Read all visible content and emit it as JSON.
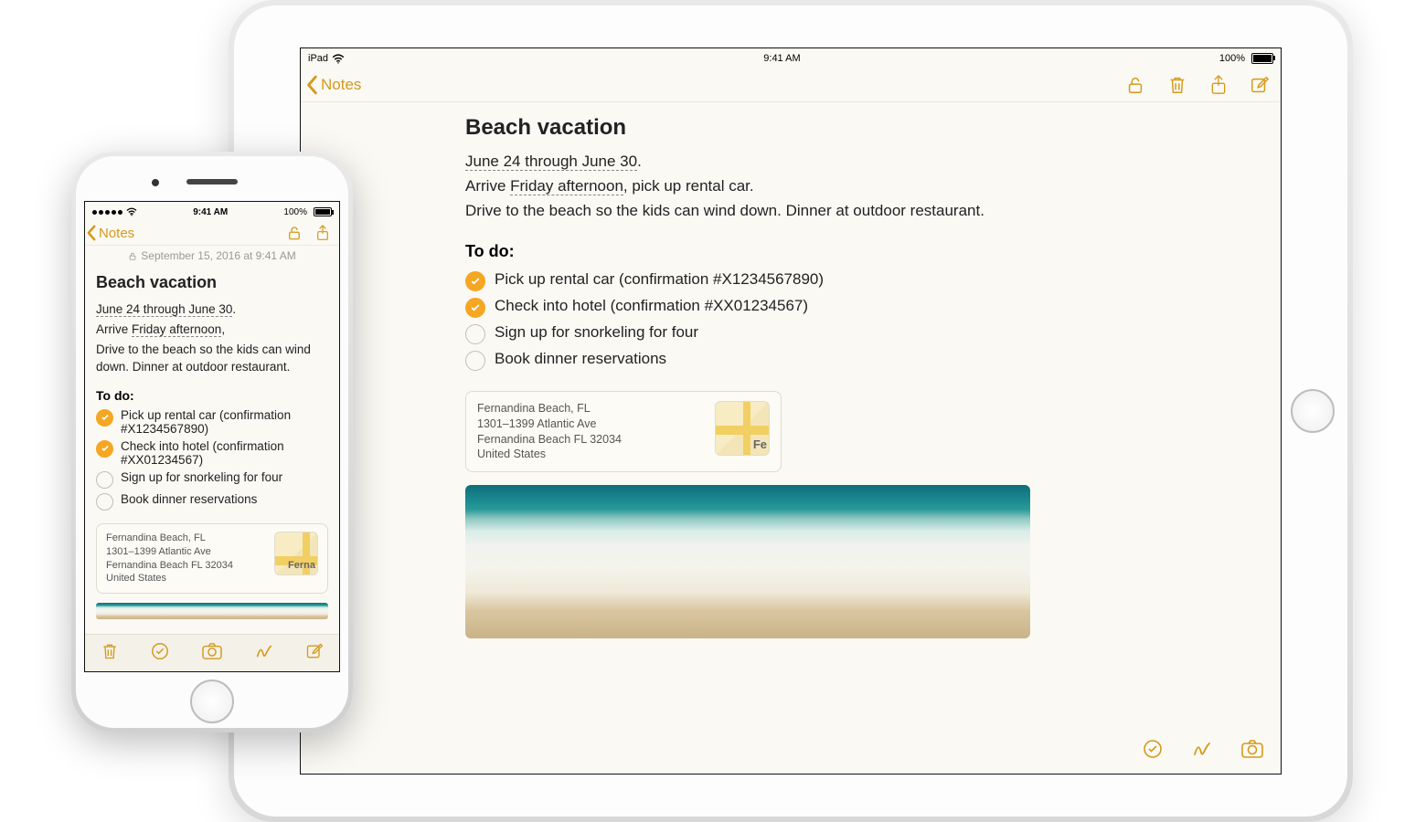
{
  "ipad": {
    "status": {
      "device": "iPad",
      "time": "9:41 AM",
      "battery": "100%"
    },
    "nav": {
      "back": "Notes"
    }
  },
  "iphone": {
    "status": {
      "time": "9:41 AM",
      "battery": "100%"
    },
    "nav": {
      "back": "Notes"
    },
    "timestamp": "September 15, 2016 at 9:41 AM"
  },
  "note": {
    "title": "Beach vacation",
    "dateRange": "June 24 through June 30",
    "arrivePrefix": "Arrive ",
    "arriveLink": "Friday afternoon",
    "arriveSuffixIpad": ", pick up rental car.",
    "arriveSuffixPhone": ",",
    "line3": "Drive to the beach so the kids can wind down. Dinner at outdoor restaurant.",
    "todoHeading": "To do:",
    "todos": [
      {
        "done": true,
        "text": "Pick up rental car (confirmation #X1234567890)"
      },
      {
        "done": true,
        "text": "Check into hotel (confirmation #XX01234567)"
      },
      {
        "done": false,
        "text": "Sign up for snorkeling for four"
      },
      {
        "done": false,
        "text": "Book dinner reservations"
      }
    ],
    "location": {
      "name": "Fernandina Beach, FL",
      "line1": "1301–1399 Atlantic Ave",
      "line2": "Fernandina Beach FL 32034",
      "country": "United States",
      "thumbLabelIpad": "Fe",
      "thumbLabelPhone": "Ferna"
    }
  }
}
